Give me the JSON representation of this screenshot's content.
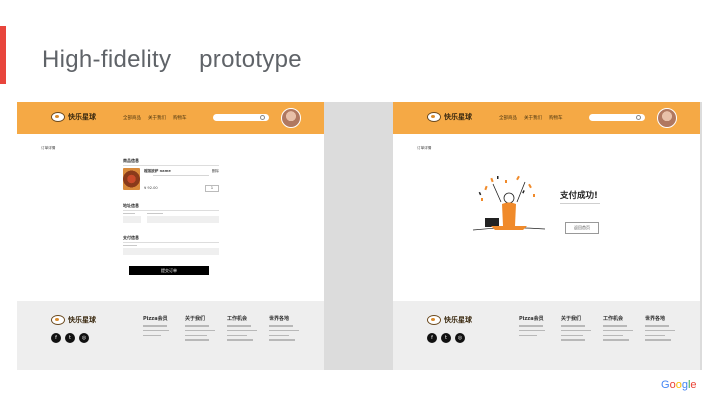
{
  "slide": {
    "title": "High-fidelity    prototype",
    "accent_color": "#e8453c",
    "footer_brand": [
      "G",
      "o",
      "o",
      "g",
      "l",
      "e"
    ],
    "footer_brand_colors": [
      "#4285f4",
      "#ea4335",
      "#fbbc05",
      "#4285f4",
      "#34a853",
      "#ea4335"
    ]
  },
  "theme": {
    "nav_color": "#f5a945",
    "footer_color": "#eeeeee",
    "button_color": "#000000"
  },
  "header": {
    "logo_text": "快乐星球",
    "nav_links": [
      "全部商品",
      "关于我们",
      "购物车"
    ],
    "search_icon": "search-icon",
    "avatar_icon": "avatar"
  },
  "checkout_page": {
    "page_label": "订单详情",
    "section_products": "商品信息",
    "product_name": "榴莲披萨 name",
    "product_price": "¥ 92.00",
    "product_action": "删除",
    "product_qty": "1",
    "section_address": "地址信息",
    "section_payment": "支付信息",
    "submit_label": "提交订单"
  },
  "success_page": {
    "page_label": "订单详情",
    "title": "支付成功!",
    "button_label": "返回首页"
  },
  "footer": {
    "logo_text": "快乐星球",
    "social_icons": [
      "facebook-icon",
      "twitter-icon",
      "instagram-icon"
    ],
    "columns": [
      "Pizza会员",
      "关于我们",
      "工作机会",
      "世界各地"
    ]
  }
}
